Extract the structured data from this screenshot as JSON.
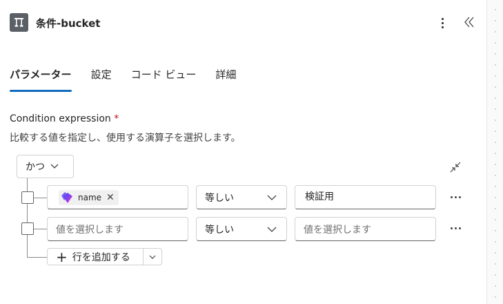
{
  "header": {
    "title": "条件-bucket",
    "icon": "condition-icon",
    "more_icon": "more-vertical-icon",
    "collapse_icon": "double-chevron-left-icon"
  },
  "tabs": [
    {
      "label": "パラメーター",
      "active": true
    },
    {
      "label": "設定",
      "active": false
    },
    {
      "label": "コード ビュー",
      "active": false
    },
    {
      "label": "詳細",
      "active": false
    }
  ],
  "condition": {
    "label": "Condition expression",
    "required_mark": "*",
    "description": "比較する値を指定し、使用する演算子を選択します。",
    "group_operator": "かつ",
    "rows": [
      {
        "left_token": "name",
        "left_placeholder": "",
        "operator": "等しい",
        "right_value": "検証用",
        "right_placeholder": ""
      },
      {
        "left_token": "",
        "left_placeholder": "値を選択します",
        "operator": "等しい",
        "right_value": "",
        "right_placeholder": "値を選択します"
      }
    ],
    "add_row_label": "行を追加する"
  },
  "colors": {
    "accent": "#0f6cbd",
    "required": "#c50f1f",
    "header_icon_bg": "#5b5f66"
  }
}
